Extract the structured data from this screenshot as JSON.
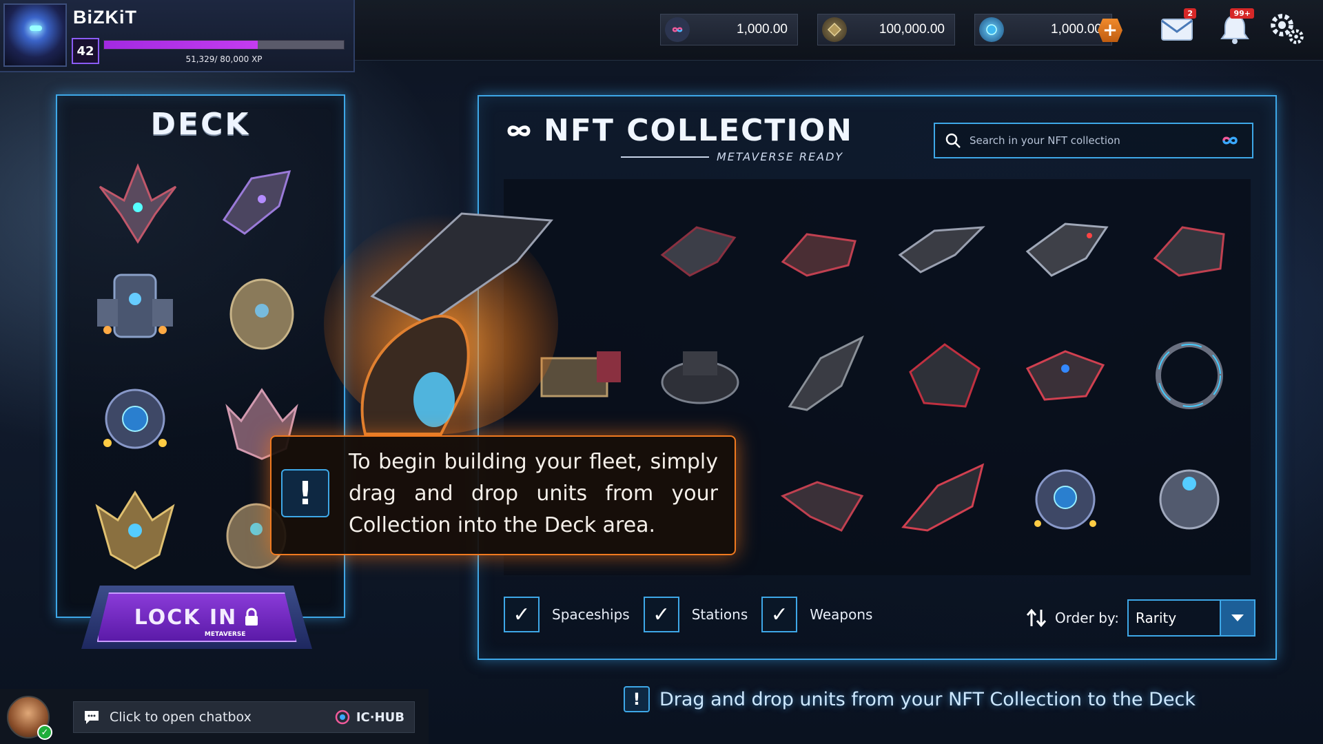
{
  "player": {
    "name": "BiZKiT",
    "level": "42",
    "xp_text": "51,329/ 80,000 XP",
    "xp_fraction": 0.64
  },
  "currencies": [
    {
      "icon": "infinity-token-icon",
      "value": "1,000.00"
    },
    {
      "icon": "gold-coin-icon",
      "value": "100,000.00"
    },
    {
      "icon": "crystal-gem-icon",
      "value": "1,000.00"
    }
  ],
  "notifications": {
    "mail_count": "2",
    "alerts_count": "99+"
  },
  "deck": {
    "title": "DECK",
    "lock_in_label": "LOCK IN",
    "lock_in_sub": "METAVERSE"
  },
  "collection": {
    "title": "NFT COLLECTION",
    "subtitle": "METAVERSE READY",
    "search_placeholder": "Search in your NFT collection",
    "filters": [
      "Spaceships",
      "Stations",
      "Weapons"
    ],
    "order_label": "Order by:",
    "order_value": "Rarity"
  },
  "tooltip": {
    "text": "To begin building your fleet, simply drag and drop units from your Collection into the Deck area."
  },
  "chat": {
    "placeholder": "Click to open chatbox",
    "hub_label": "IC·HUB"
  },
  "hint": {
    "text": "Drag and drop units from your NFT Collection to the Deck"
  },
  "colors": {
    "panel_border": "#3ea8e8",
    "accent_purple": "#8b5cf6",
    "tooltip_border": "#f07a20"
  }
}
